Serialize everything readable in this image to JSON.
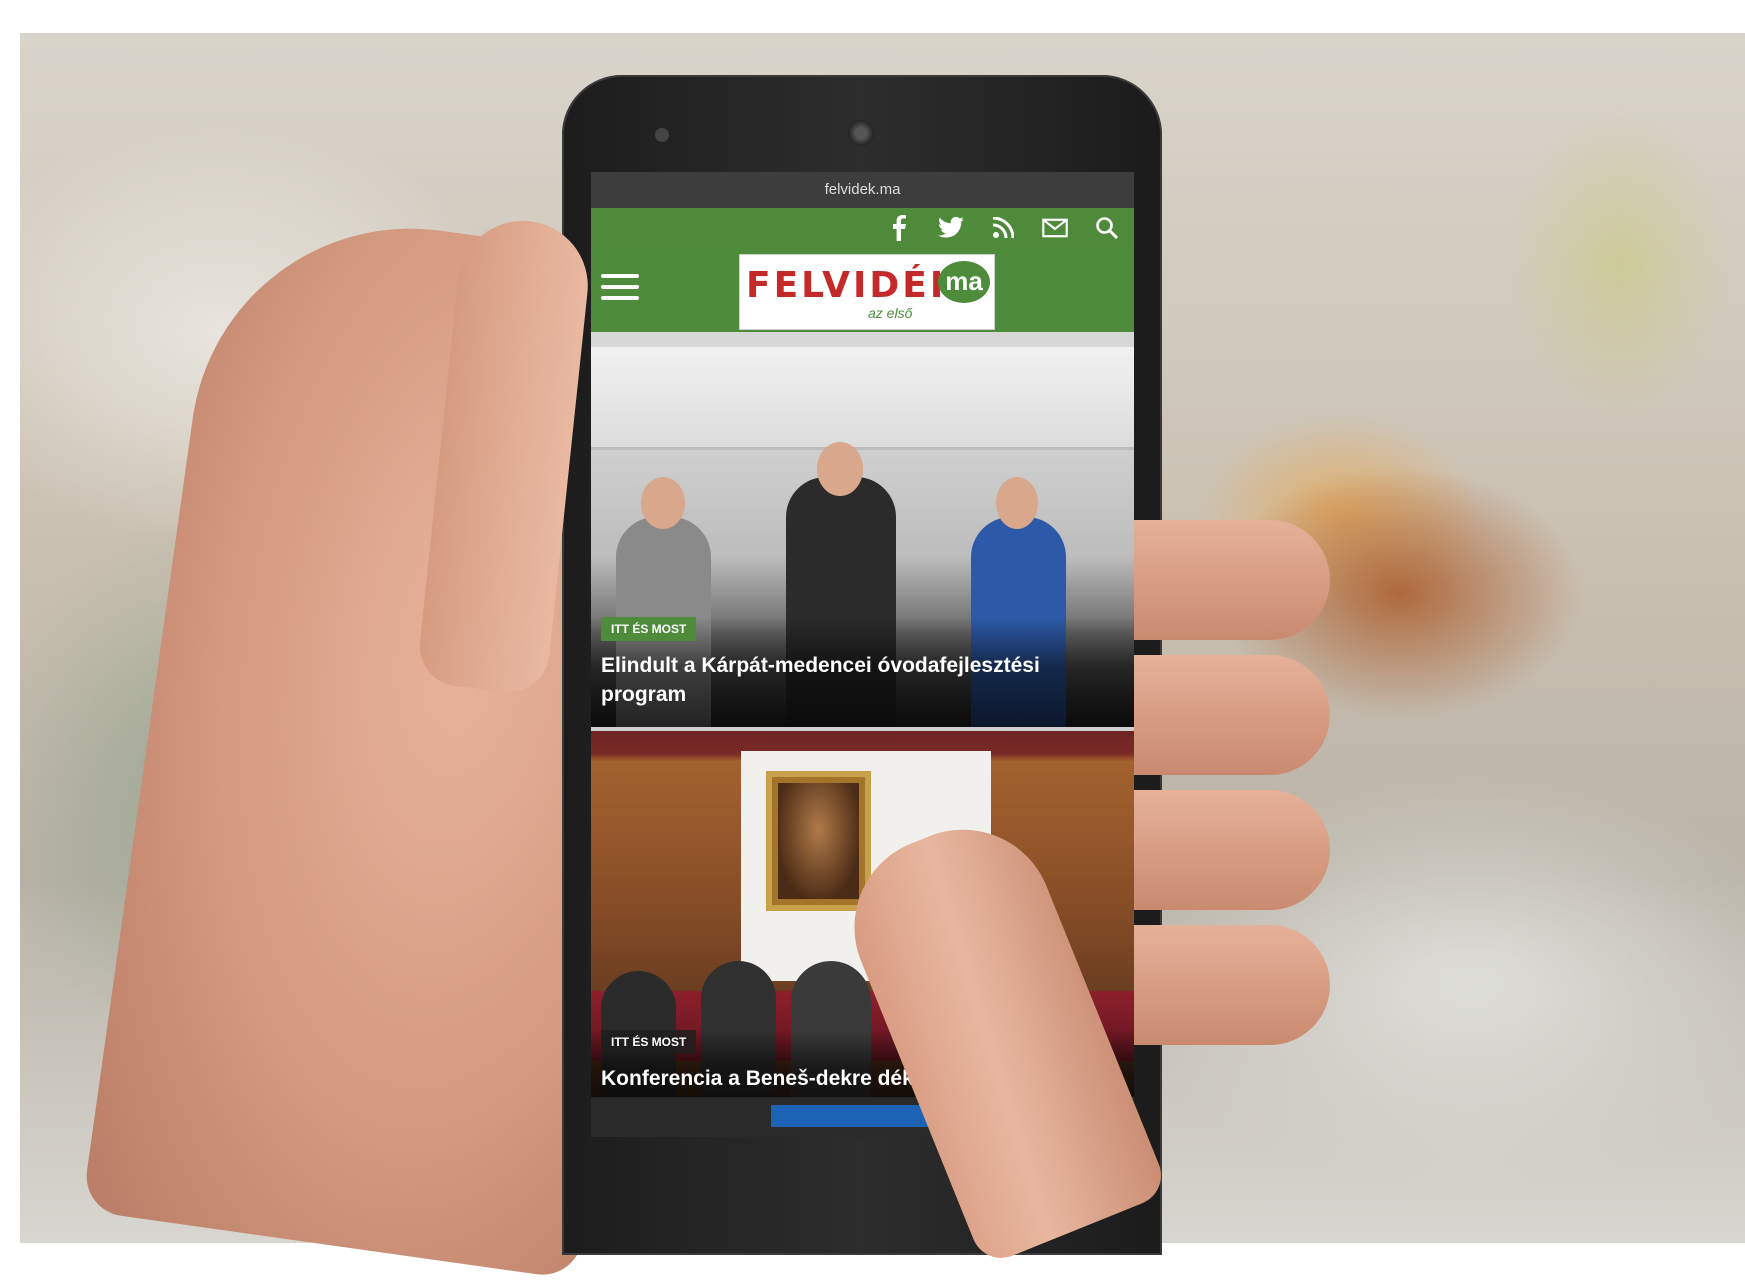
{
  "browser": {
    "url": "felvidek.ma"
  },
  "social": {
    "icons": [
      "facebook-icon",
      "twitter-icon",
      "rss-icon",
      "mail-icon",
      "search-icon"
    ]
  },
  "header": {
    "logo_word": "FELVIDÉK",
    "logo_suffix": "ma",
    "logo_tagline": "az első",
    "menu_icon": "hamburger-menu-icon"
  },
  "articles": [
    {
      "category": "ITT ÉS MOST",
      "title": "Elindult a Kárpát-medencei óvodafejlesztési program"
    },
    {
      "category": "ITT ÉS MOST",
      "title": "Konferencia a Beneš-dekre déki módra"
    }
  ],
  "colors": {
    "brand_green": "#4e8c3b",
    "logo_red": "#c52a2a"
  }
}
